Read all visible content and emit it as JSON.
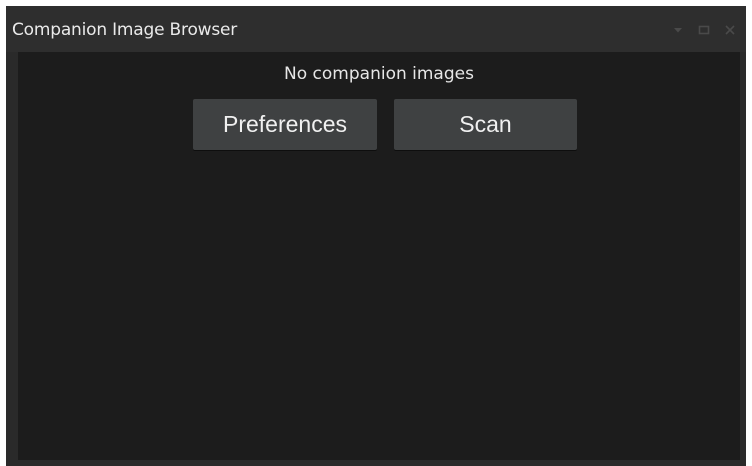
{
  "window": {
    "title": "Companion Image Browser",
    "controls": [
      {
        "icon": "chevron-down-icon"
      },
      {
        "icon": "maximize-icon"
      },
      {
        "icon": "close-icon"
      }
    ]
  },
  "content": {
    "message": "No companion images",
    "buttons": {
      "preferences_label": "Preferences",
      "scan_label": "Scan"
    }
  },
  "colors": {
    "titlebar_bg": "#2e2e2e",
    "content_bg": "#1c1c1c",
    "button_bg": "#3f4142",
    "text": "#e6e6e6",
    "control_icons": "#4a4a4a"
  }
}
